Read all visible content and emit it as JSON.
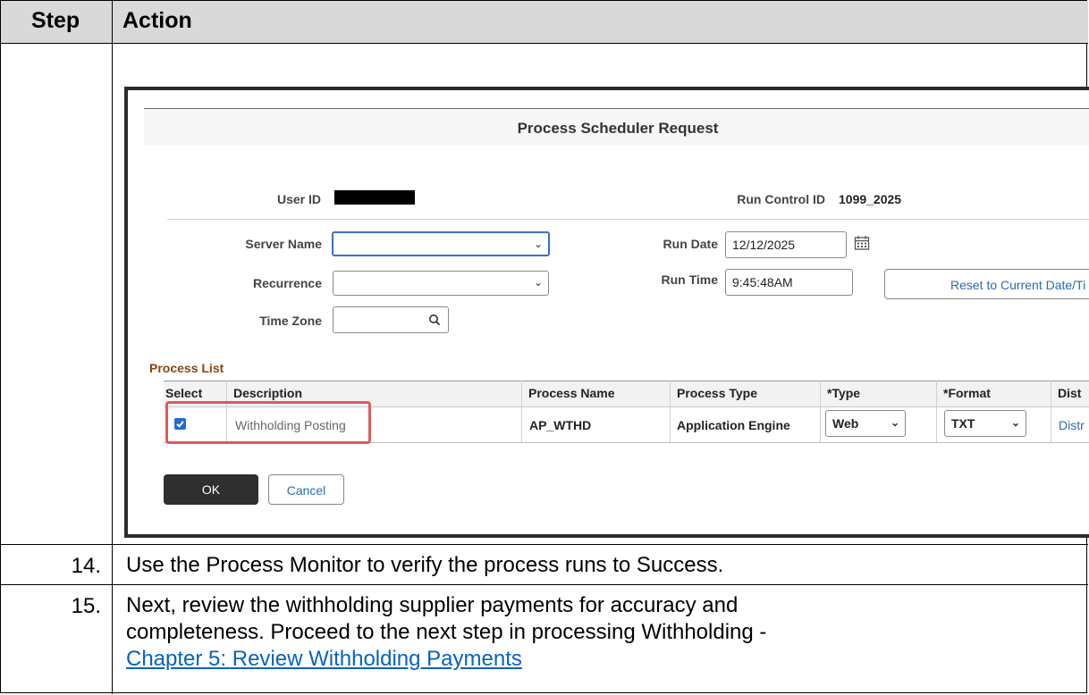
{
  "table": {
    "header": {
      "step": "Step",
      "action": "Action"
    },
    "rows": [
      {
        "step": "14.",
        "text": "Use the Process Monitor to verify the process runs to Success."
      },
      {
        "step": "15.",
        "line1": "Next, review the withholding supplier payments for accuracy and",
        "line2": "completeness. Proceed to the next step in processing Withholding -",
        "link": "Chapter 5: Review Withholding Payments"
      }
    ]
  },
  "screenshot": {
    "title": "Process Scheduler Request",
    "user_id_label": "User ID",
    "run_control_label": "Run Control ID",
    "run_control_value": "1099_2025",
    "server_name_label": "Server Name",
    "server_name_value": "",
    "recurrence_label": "Recurrence",
    "recurrence_value": "",
    "time_zone_label": "Time Zone",
    "time_zone_value": "",
    "run_date_label": "Run Date",
    "run_date_value": "12/12/2025",
    "run_time_label": "Run Time",
    "run_time_value": "9:45:48AM",
    "reset_button": "Reset to Current Date/Ti",
    "process_list_label": "Process List",
    "columns": {
      "select": "Select",
      "description": "Description",
      "process_name": "Process Name",
      "process_type": "Process Type",
      "type": "*Type",
      "format": "*Format",
      "dist": "Dist"
    },
    "row": {
      "selected": true,
      "description": "Withholding Posting",
      "process_name": "AP_WTHD",
      "process_type": "Application Engine",
      "type": "Web",
      "format": "TXT",
      "dist": "Distr"
    },
    "ok_button": "OK",
    "cancel_button": "Cancel",
    "colors": {
      "highlight": "#e05a5a",
      "link": "#2a6bb5",
      "section": "#8a4513",
      "ok_bg": "#2f2f2f"
    }
  }
}
